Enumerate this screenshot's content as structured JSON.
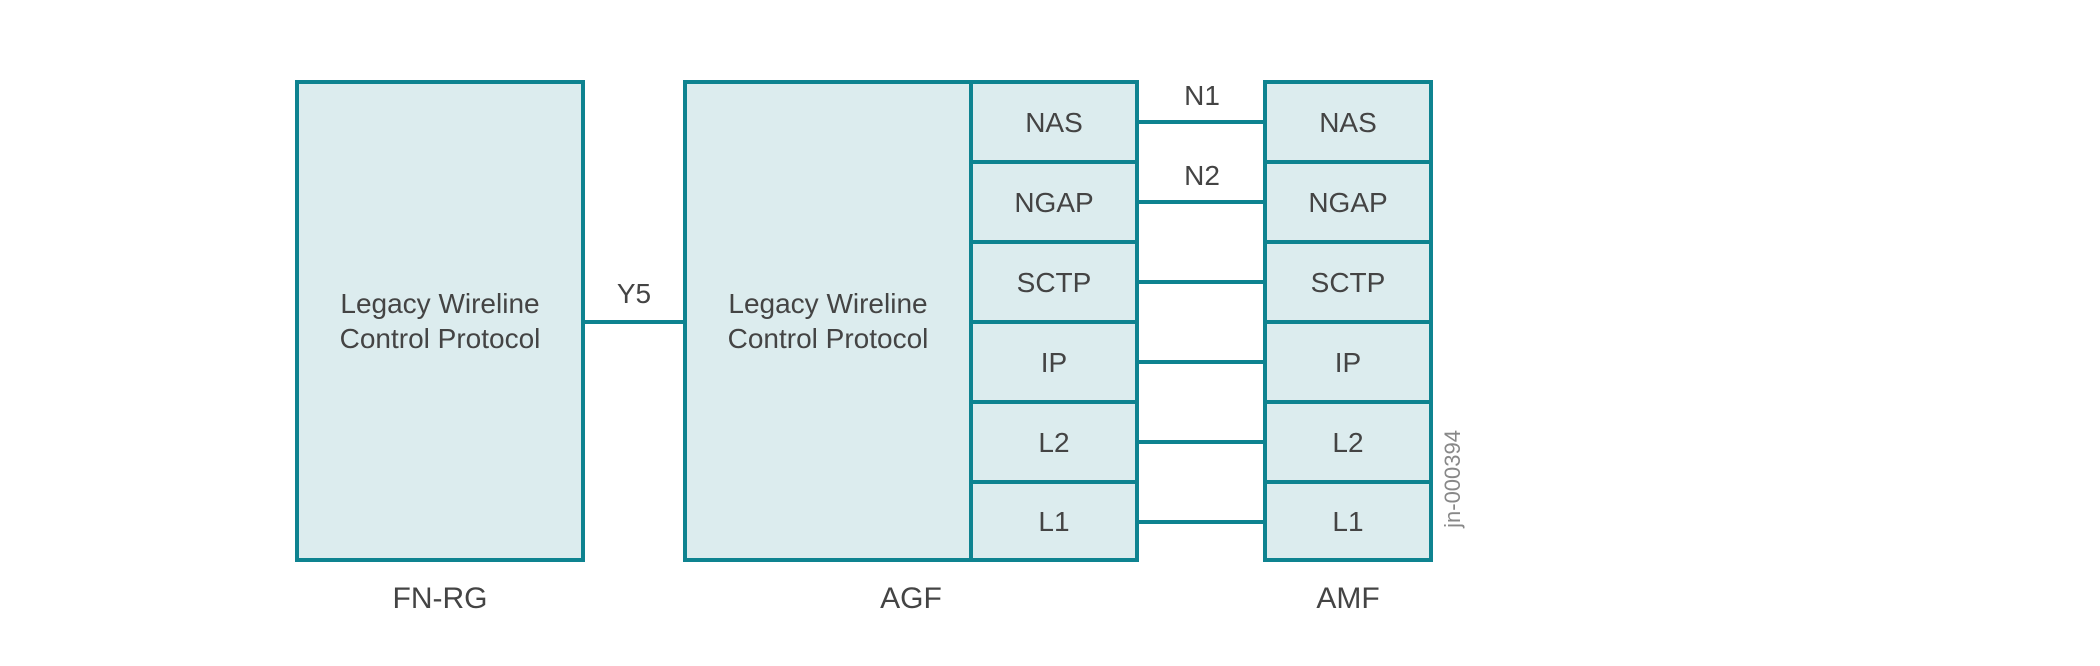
{
  "fnrg": {
    "box_label": "Legacy Wireline\nControl Protocol",
    "title": "FN-RG"
  },
  "agf": {
    "left_box_label": "Legacy Wireline\nControl Protocol",
    "stack": [
      "NAS",
      "NGAP",
      "SCTP",
      "IP",
      "L2",
      "L1"
    ],
    "title": "AGF"
  },
  "amf": {
    "stack": [
      "NAS",
      "NGAP",
      "SCTP",
      "IP",
      "L2",
      "L1"
    ],
    "title": "AMF"
  },
  "links": {
    "y5": "Y5",
    "n1": "N1",
    "n2": "N2"
  },
  "footer_id": "jn-000394"
}
